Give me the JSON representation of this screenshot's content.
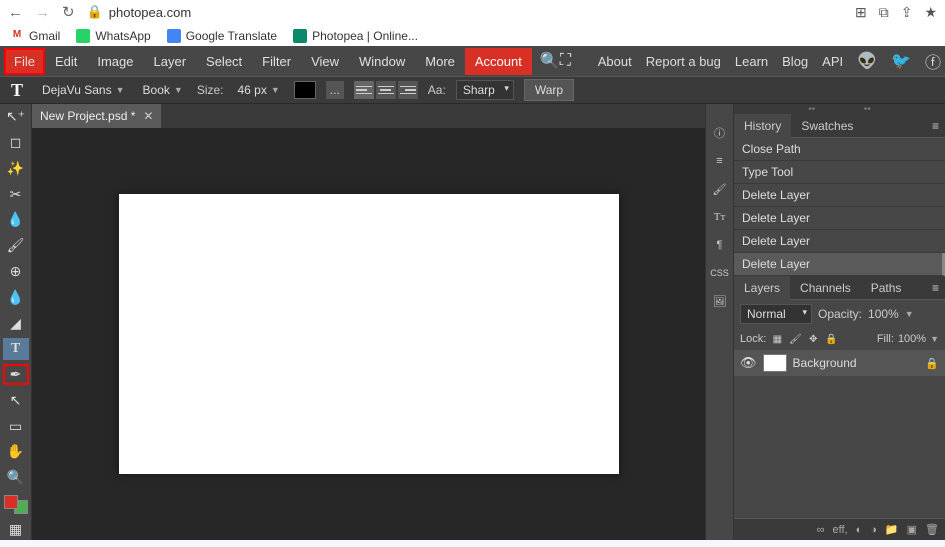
{
  "browser": {
    "url": "photopea.com",
    "bookmarks": [
      {
        "label": "Gmail",
        "icon_bg": "#fff",
        "icon_text": "M",
        "icon_color": "#d93025"
      },
      {
        "label": "WhatsApp",
        "icon_bg": "#25d366",
        "icon_text": "●",
        "icon_color": "#fff"
      },
      {
        "label": "Google Translate",
        "icon_bg": "#4285f4",
        "icon_text": "G",
        "icon_color": "#fff"
      },
      {
        "label": "Photopea | Online...",
        "icon_bg": "#0a8a6a",
        "icon_text": "◆",
        "icon_color": "#fff"
      }
    ]
  },
  "menus": {
    "items": [
      "File",
      "Edit",
      "Image",
      "Layer",
      "Select",
      "Filter",
      "View",
      "Window",
      "More"
    ],
    "account": "Account",
    "right": [
      "About",
      "Report a bug",
      "Learn",
      "Blog",
      "API"
    ]
  },
  "options": {
    "font_family": "DejaVu Sans",
    "font_weight": "Book",
    "size_label": "Size:",
    "size_value": "46 px",
    "aa_label": "Aa:",
    "aa_value": "Sharp",
    "warp": "Warp",
    "more": "..."
  },
  "doc_tab": {
    "title": "New Project.psd *"
  },
  "panels": {
    "history_tab": "History",
    "swatches_tab": "Swatches",
    "history": [
      "Close Path",
      "Type Tool",
      "Delete Layer",
      "Delete Layer",
      "Delete Layer",
      "Delete Layer"
    ],
    "layers_tab": "Layers",
    "channels_tab": "Channels",
    "paths_tab": "Paths",
    "blend_mode": "Normal",
    "opacity_label": "Opacity:",
    "opacity_value": "100%",
    "lock_label": "Lock:",
    "fill_label": "Fill:",
    "fill_value": "100%",
    "layer_name": "Background",
    "footer_eff": "eff,"
  },
  "side_tool_labels": {
    "css": "CSS",
    "tt": "Tт"
  }
}
